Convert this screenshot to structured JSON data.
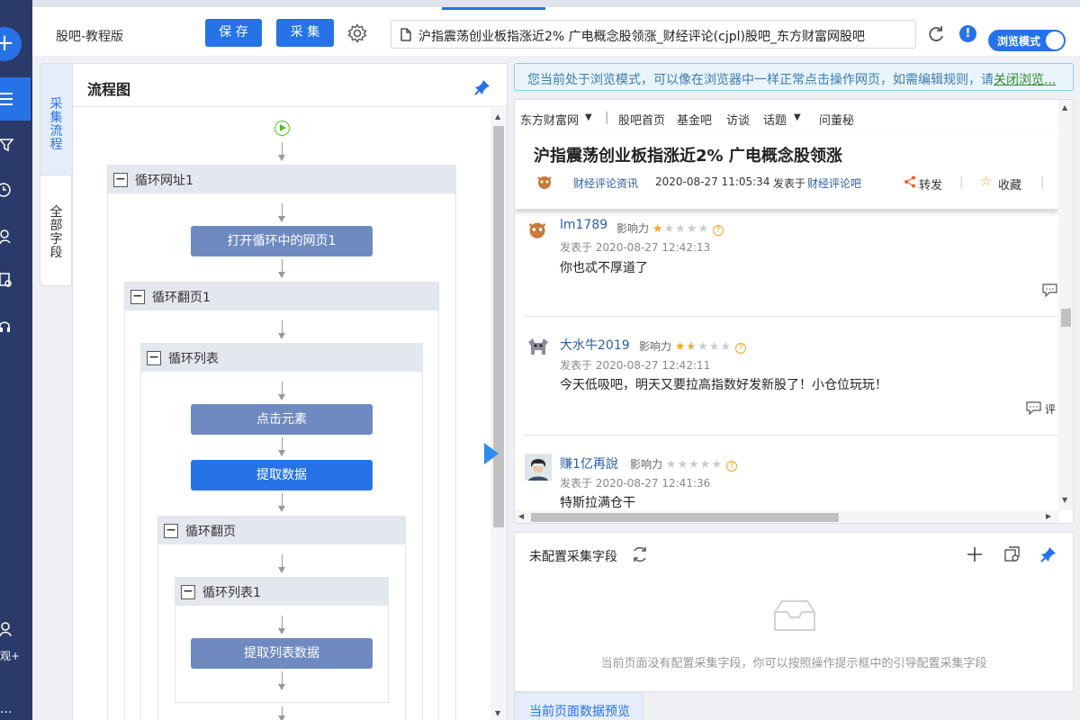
{
  "app": {
    "title": "股吧-教程版",
    "save_label": "保 存",
    "collect_label": "采 集",
    "url": "沪指震荡创业板指涨近2% 广电概念股领涨_财经评论(cjpl)股吧_东方财富网股吧",
    "mode_label": "浏览模式",
    "accent_color": "#2673e8"
  },
  "leftnav": {
    "user_label": "观+",
    "more_label": "..."
  },
  "side_tabs": [
    {
      "label": "采集流程"
    },
    {
      "label": "全部字段"
    }
  ],
  "flow": {
    "title": "流程图",
    "loops": [
      "循环网址1",
      "循环翻页1",
      "循环列表",
      "循环翻页",
      "循环列表1"
    ],
    "nodes": [
      "打开循环中的网页1",
      "点击元素",
      "提取数据",
      "提取列表数据"
    ]
  },
  "notice": {
    "text": "您当前处于浏览模式，可以像在浏览器中一样正常点击操作网页，如需编辑规则，请",
    "link": "关闭浏览..."
  },
  "browser": {
    "nav": [
      "东方财富网",
      "股吧首页",
      "基金吧",
      "访谈",
      "话题",
      "问董秘"
    ],
    "article": {
      "title": "沪指震荡创业板指涨近2% 广电概念股领涨",
      "author": "财经评论资讯",
      "time": "2020-08-27 11:05:34",
      "posted_in_prefix": "发表于",
      "posted_in": "财经评论吧",
      "share": "转发",
      "fav": "收藏"
    },
    "influence_label": "影响力",
    "comments": [
      {
        "name": "lm1789",
        "stars": 1,
        "time": "发表于 2020-08-27 12:42:13",
        "text": "你也忒不厚道了"
      },
      {
        "name": "大水牛2019",
        "stars": 1.5,
        "time": "发表于 2020-08-27 12:42:11",
        "text": "今天低吸吧，明天又要拉高指数好发新股了！小仓位玩玩！",
        "reply": "评"
      },
      {
        "name": "赚1亿再說",
        "stars": 0,
        "time": "发表于 2020-08-27 12:41:36",
        "text": "特斯拉满仓干"
      }
    ]
  },
  "fields": {
    "title": "未配置采集字段",
    "empty_text": "当前页面没有配置采集字段，你可以按照操作提示框中的引导配置采集字段"
  },
  "preview": {
    "tab_label": "当前页面数据预览"
  }
}
